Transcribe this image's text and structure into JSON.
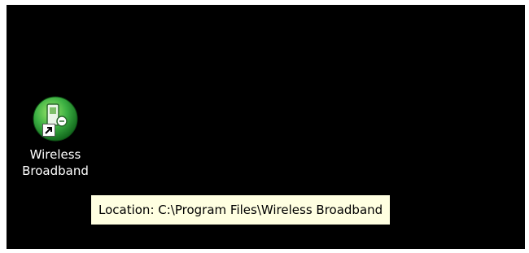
{
  "desktop": {
    "background_color": "#000000",
    "shortcut": {
      "icon": "wireless-broadband-app-icon",
      "overlay_icon": "shortcut-arrow-icon",
      "label_line1": "Wireless",
      "label_line2": "Broadband",
      "icon_color": "#3cb043"
    },
    "tooltip": {
      "text": "Location: C:\\Program Files\\Wireless Broadband",
      "background_color": "#ffffe1"
    }
  }
}
